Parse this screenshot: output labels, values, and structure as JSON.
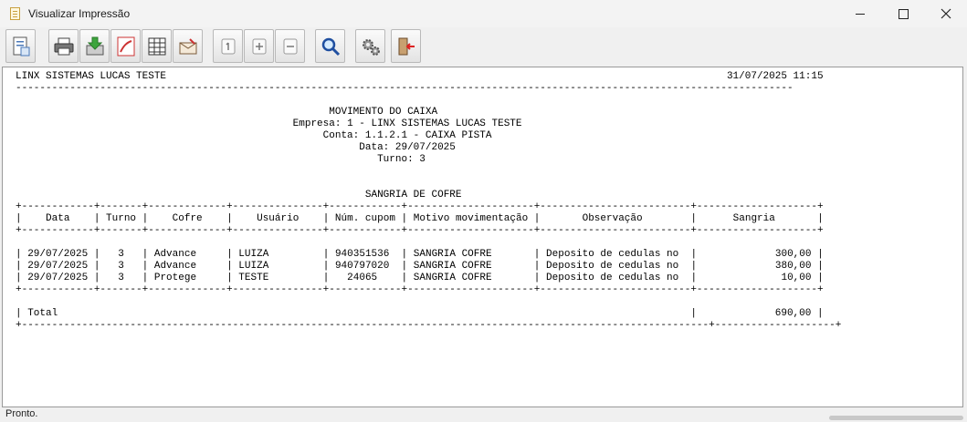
{
  "window": {
    "title": "Visualizar Impressão"
  },
  "toolbar": {
    "buttons": [
      {
        "icon": "page-setup-icon"
      },
      {
        "icon": "printer-icon"
      },
      {
        "icon": "save-icon"
      },
      {
        "icon": "pdf-export-icon"
      },
      {
        "icon": "spreadsheet-export-icon"
      },
      {
        "icon": "email-icon"
      },
      {
        "icon": "page-number-icon"
      },
      {
        "icon": "zoom-in-icon"
      },
      {
        "icon": "zoom-out-icon"
      },
      {
        "icon": "search-icon"
      },
      {
        "icon": "settings-icon"
      },
      {
        "icon": "exit-icon"
      }
    ]
  },
  "report": {
    "company": "LINX SISTEMAS LUCAS TESTE",
    "datetime": "31/07/2025 11:15",
    "heading": "MOVIMENTO DO CAIXA",
    "empresa": "Empresa: 1 - LINX SISTEMAS LUCAS TESTE",
    "conta": "Conta: 1.1.2.1 - CAIXA PISTA",
    "data": "Data: 29/07/2025",
    "turno": "Turno: 3",
    "section": "SANGRIA DE COFRE",
    "columns": [
      "Data",
      "Turno",
      "Cofre",
      "Usuário",
      "Núm. cupom",
      "Motivo movimentação",
      "Observação",
      "Sangria"
    ],
    "rows": [
      [
        "29/07/2025",
        "3",
        "Advance",
        "LUIZA",
        "940351536",
        "SANGRIA COFRE",
        "Deposito de cedulas no",
        "300,00"
      ],
      [
        "29/07/2025",
        "3",
        "Advance",
        "LUIZA",
        "940797020",
        "SANGRIA COFRE",
        "Deposito de cedulas no",
        "380,00"
      ],
      [
        "29/07/2025",
        "3",
        "Protege",
        "TESTE",
        "24065",
        "SANGRIA COFRE",
        "Deposito de cedulas no",
        "10,00"
      ]
    ],
    "total_label": "Total",
    "total_value": "690,00"
  },
  "status": {
    "text": "Pronto."
  }
}
